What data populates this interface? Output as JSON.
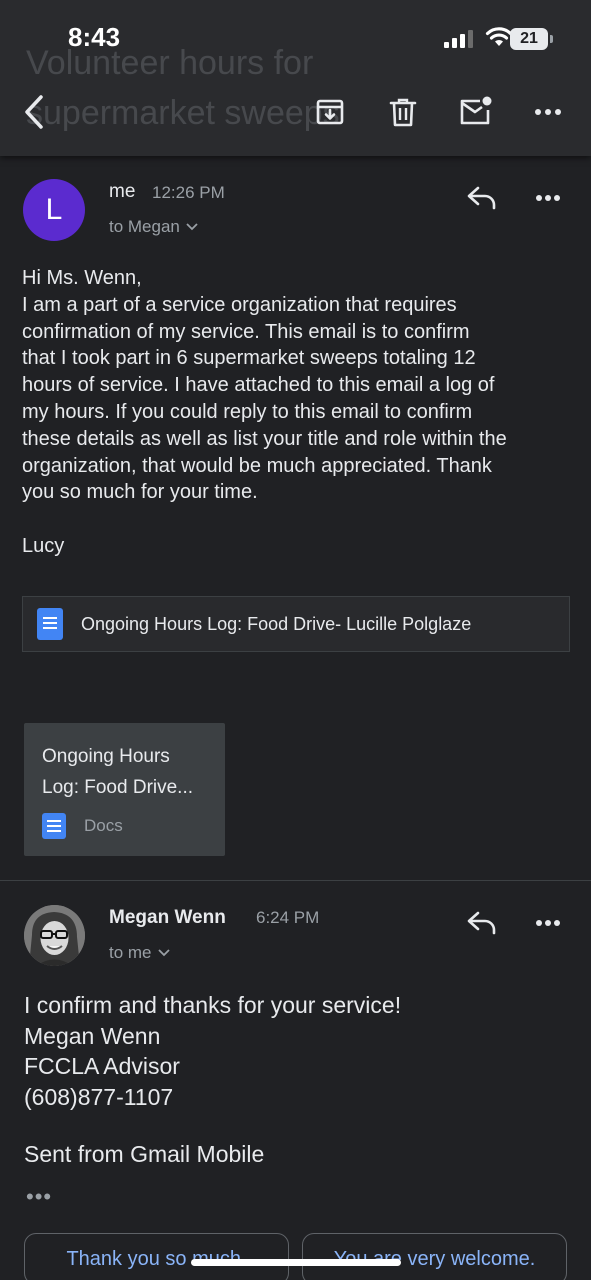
{
  "status": {
    "time": "8:43",
    "battery": "21"
  },
  "header": {
    "ghost_title_line1": "Volunteer hours for",
    "ghost_title_line2": "supermarket sweeps"
  },
  "message1": {
    "avatar_letter": "L",
    "sender": "me",
    "time": "12:26 PM",
    "recipient": "to Megan",
    "body": [
      "Hi Ms. Wenn,",
      "I am a part of a service organization that requires",
      "confirmation of my service. This email is to confirm",
      "that I took part in 6 supermarket sweeps totaling 12",
      "hours of service. I have attached to this email a log of",
      "my hours. If you could reply to this email to confirm",
      "these details as well as list your title and role within the",
      "organization, that would be much appreciated. Thank",
      "you so much for your time."
    ],
    "signoff": "Lucy",
    "attachment_link": "Ongoing Hours Log: Food Drive- Lucille Polglaze",
    "attachment_card": {
      "title_line1": "Ongoing Hours",
      "title_line2": "Log: Food Drive...",
      "type": "Docs"
    }
  },
  "message2": {
    "sender": "Megan Wenn",
    "time": "6:24 PM",
    "recipient": "to me",
    "body": [
      "I confirm and thanks for your service!",
      "Megan Wenn",
      "FCCLA Advisor",
      "(608)877-1107"
    ],
    "footer": "Sent from Gmail Mobile",
    "trimmed": "•••"
  },
  "smart_replies": [
    "Thank you so much.",
    "You are very welcome."
  ],
  "colors": {
    "avatar": "#5b2bcf",
    "link": "#8ab4f8",
    "docs_blue": "#4285f4",
    "background": "#202124"
  }
}
